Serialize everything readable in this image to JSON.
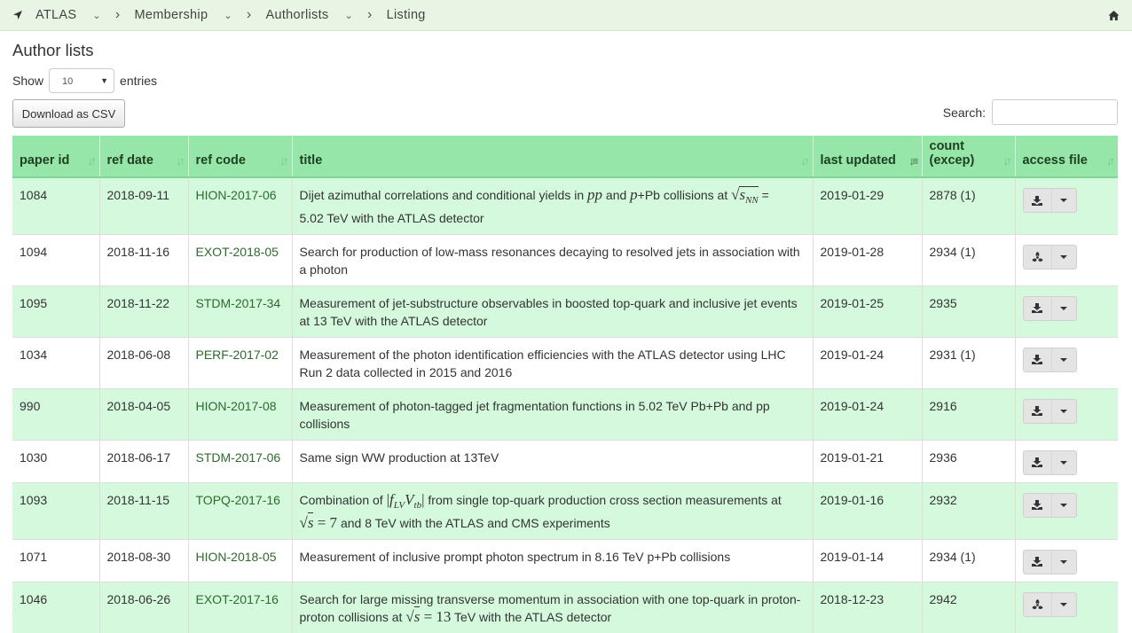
{
  "breadcrumb": [
    {
      "label": "ATLAS"
    },
    {
      "label": "Membership"
    },
    {
      "label": "Authorlists"
    },
    {
      "label": "Listing"
    }
  ],
  "page_title": "Author lists",
  "length_control": {
    "prefix": "Show",
    "value": "10",
    "suffix": "entries"
  },
  "download_label": "Download as CSV",
  "search_label": "Search:",
  "search_value": "",
  "columns": [
    {
      "label": "paper id",
      "sorted": false
    },
    {
      "label": "ref date",
      "sorted": false
    },
    {
      "label": "ref code",
      "sorted": false
    },
    {
      "label": "title",
      "sorted": false
    },
    {
      "label": "last updated",
      "sorted": true
    },
    {
      "label": "count (excep)",
      "sorted": false
    },
    {
      "label": "access file",
      "sorted": false
    }
  ],
  "rows": [
    {
      "paper_id": "1084",
      "ref_date": "2018-09-11",
      "ref_code": "HION-2017-06",
      "last_updated": "2019-01-29",
      "count": "2878 (1)",
      "file_icon": "download-icon"
    },
    {
      "paper_id": "1094",
      "ref_date": "2018-11-16",
      "ref_code": "EXOT-2018-05",
      "title": "Search for production of low-mass resonances decaying to resolved jets in association with a photon",
      "last_updated": "2019-01-28",
      "count": "2934 (1)",
      "file_icon": "biohazard-icon"
    },
    {
      "paper_id": "1095",
      "ref_date": "2018-11-22",
      "ref_code": "STDM-2017-34",
      "title": "Measurement of jet-substructure observables in boosted top-quark and inclusive jet events at 13 TeV with the ATLAS detector",
      "last_updated": "2019-01-25",
      "count": "2935",
      "file_icon": "download-icon"
    },
    {
      "paper_id": "1034",
      "ref_date": "2018-06-08",
      "ref_code": "PERF-2017-02",
      "title": "Measurement of the photon identification efficiencies with the ATLAS detector using LHC Run 2 data collected in 2015 and 2016",
      "last_updated": "2019-01-24",
      "count": "2931 (1)",
      "file_icon": "download-icon"
    },
    {
      "paper_id": "990",
      "ref_date": "2018-04-05",
      "ref_code": "HION-2017-08",
      "title": "Measurement of photon-tagged jet fragmentation functions in 5.02 TeV Pb+Pb and pp collisions",
      "last_updated": "2019-01-24",
      "count": "2916",
      "file_icon": "download-icon"
    },
    {
      "paper_id": "1030",
      "ref_date": "2018-06-17",
      "ref_code": "STDM-2017-06",
      "title": "Same sign WW production at 13TeV",
      "last_updated": "2019-01-21",
      "count": "2936",
      "file_icon": "download-icon"
    },
    {
      "paper_id": "1093",
      "ref_date": "2018-11-15",
      "ref_code": "TOPQ-2017-16",
      "last_updated": "2019-01-16",
      "count": "2932",
      "file_icon": "download-icon"
    },
    {
      "paper_id": "1071",
      "ref_date": "2018-08-30",
      "ref_code": "HION-2018-05",
      "title": "Measurement of inclusive prompt photon spectrum in 8.16 TeV p+Pb collisions",
      "last_updated": "2019-01-14",
      "count": "2934 (1)",
      "file_icon": "download-icon"
    },
    {
      "paper_id": "1046",
      "ref_date": "2018-06-26",
      "ref_code": "EXOT-2017-16",
      "last_updated": "2018-12-23",
      "count": "2942",
      "file_icon": "biohazard-icon"
    }
  ],
  "math_titles": {
    "r0": {
      "a": "Dijet azimuthal correlations and conditional yields in ",
      "pp": "pp",
      "and": " and ",
      "p": "p",
      "pb": "+Pb collisions at ",
      "s": "s",
      "nn": "NN",
      "eq": " =",
      "b": "5.02 TeV with the ATLAS detector"
    },
    "r6": {
      "a": "Combination of ",
      "f": "f",
      "lv": "LV",
      "v": "V",
      "tb": "tb",
      "b": " from single top-quark production cross section measurements at",
      "s": "s",
      "eq": " = 7",
      "c": " and 8 TeV with the ATLAS and CMS experiments"
    },
    "r8": {
      "a": "Search for large missing transverse momentum in association with one top-quark in proton-",
      "b": "proton collisions at ",
      "s": "s",
      "eq": " = 13",
      "c": " TeV with the ATLAS detector"
    }
  }
}
